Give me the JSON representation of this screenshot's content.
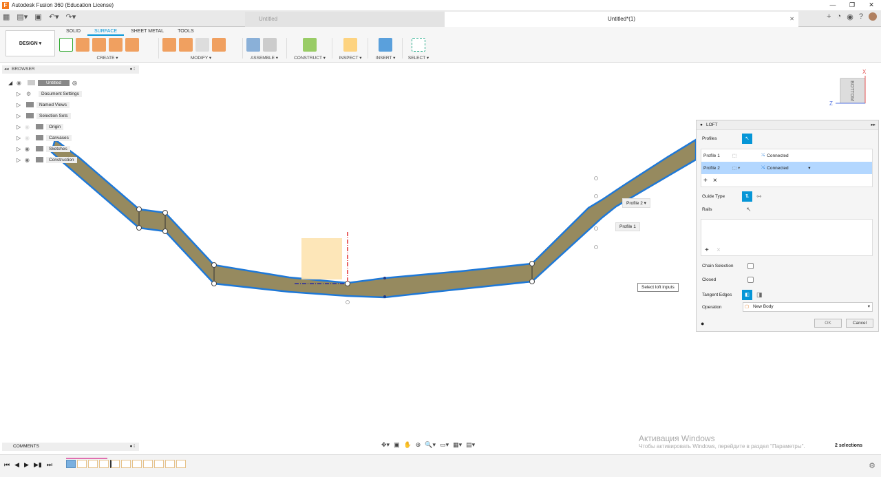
{
  "title": "Autodesk Fusion 360 (Education License)",
  "tabs": {
    "inactive": "Untitled",
    "active": "Untitled*(1)"
  },
  "ribbon": {
    "design": "DESIGN ▾",
    "workspaces": [
      "SOLID",
      "SURFACE",
      "SHEET METAL",
      "TOOLS"
    ],
    "groups": [
      "CREATE ▾",
      "MODIFY ▾",
      "ASSEMBLE ▾",
      "CONSTRUCT ▾",
      "INSPECT ▾",
      "INSERT ▾",
      "SELECT ▾"
    ]
  },
  "browser": {
    "label": "BROWSER",
    "root": "Untitled",
    "items": [
      "Document Settings",
      "Named Views",
      "Selection Sets",
      "Origin",
      "Canvases",
      "Sketches",
      "Construction"
    ]
  },
  "comments": "COMMENTS",
  "viewcube": {
    "face": "BOTTOM",
    "x": "X",
    "z": "Z"
  },
  "loft": {
    "title": "LOFT",
    "profiles_label": "Profiles",
    "rows": [
      {
        "name": "Profile 1",
        "status": "Connected"
      },
      {
        "name": "Profile 2",
        "status": "Connected"
      }
    ],
    "guide_type": "Guide Type",
    "rails": "Rails",
    "chain_selection": "Chain Selection",
    "closed": "Closed",
    "tangent_edges": "Tangent Edges",
    "operation_label": "Operation",
    "operation_value": "New Body",
    "ok": "OK",
    "cancel": "Cancel",
    "add": "+",
    "remove": "×"
  },
  "canvas": {
    "profile2_tag": "Profile 2 ▾",
    "profile1_tag": "Profile 1",
    "hint": "Select loft inputs"
  },
  "activation": {
    "title": "Активация Windows",
    "sub": "Чтобы активировать Windows, перейдите в раздел \"Параметры\"."
  },
  "status": {
    "selections": "2 selections"
  },
  "colors": {
    "accent": "#0696d7",
    "surface": "#968a5f",
    "edge": "#1e78d7"
  }
}
